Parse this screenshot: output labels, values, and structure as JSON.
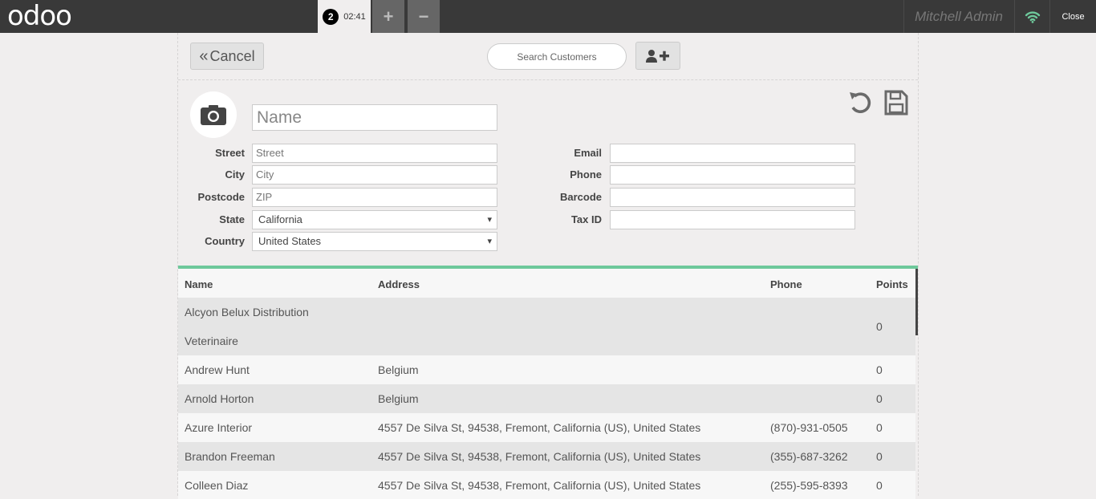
{
  "topbar": {
    "logo": "odoo",
    "order_number": "2",
    "order_time": "02:41",
    "add_order": "+",
    "remove_order": "−",
    "user": "Mitchell Admin",
    "close": "Close"
  },
  "toolbar": {
    "cancel": "Cancel",
    "search_placeholder": "Search Customers"
  },
  "form": {
    "name_placeholder": "Name",
    "labels": {
      "street": "Street",
      "city": "City",
      "postcode": "Postcode",
      "state": "State",
      "country": "Country",
      "email": "Email",
      "phone": "Phone",
      "barcode": "Barcode",
      "tax_id": "Tax ID"
    },
    "placeholders": {
      "street": "Street",
      "city": "City",
      "zip": "ZIP"
    },
    "values": {
      "state": "California",
      "country": "United States",
      "email": "",
      "phone": "",
      "barcode": "",
      "tax_id": ""
    }
  },
  "list": {
    "headers": {
      "name": "Name",
      "address": "Address",
      "phone": "Phone",
      "points": "Points"
    },
    "rows": [
      {
        "name": "Alcyon Belux Distribution",
        "name2": "Veterinaire",
        "address": "",
        "phone": "",
        "points": "0"
      },
      {
        "name": "Andrew Hunt",
        "address": "Belgium",
        "phone": "",
        "points": "0"
      },
      {
        "name": "Arnold Horton",
        "address": "Belgium",
        "phone": "",
        "points": "0"
      },
      {
        "name": "Azure Interior",
        "address": "4557 De Silva St, 94538, Fremont, California (US), United States",
        "phone": "(870)-931-0505",
        "points": "0"
      },
      {
        "name": "Brandon Freeman",
        "address": "4557 De Silva St, 94538, Fremont, California (US), United States",
        "phone": "(355)-687-3262",
        "points": "0"
      },
      {
        "name": "Colleen Diaz",
        "address": "4557 De Silva St, 94538, Fremont, California (US), United States",
        "phone": "(255)-595-8393",
        "points": "0"
      }
    ]
  },
  "colors": {
    "topbar": "#393939",
    "accent": "#6ec89b",
    "wifi": "#6ec89b",
    "background": "#f0eeee"
  }
}
